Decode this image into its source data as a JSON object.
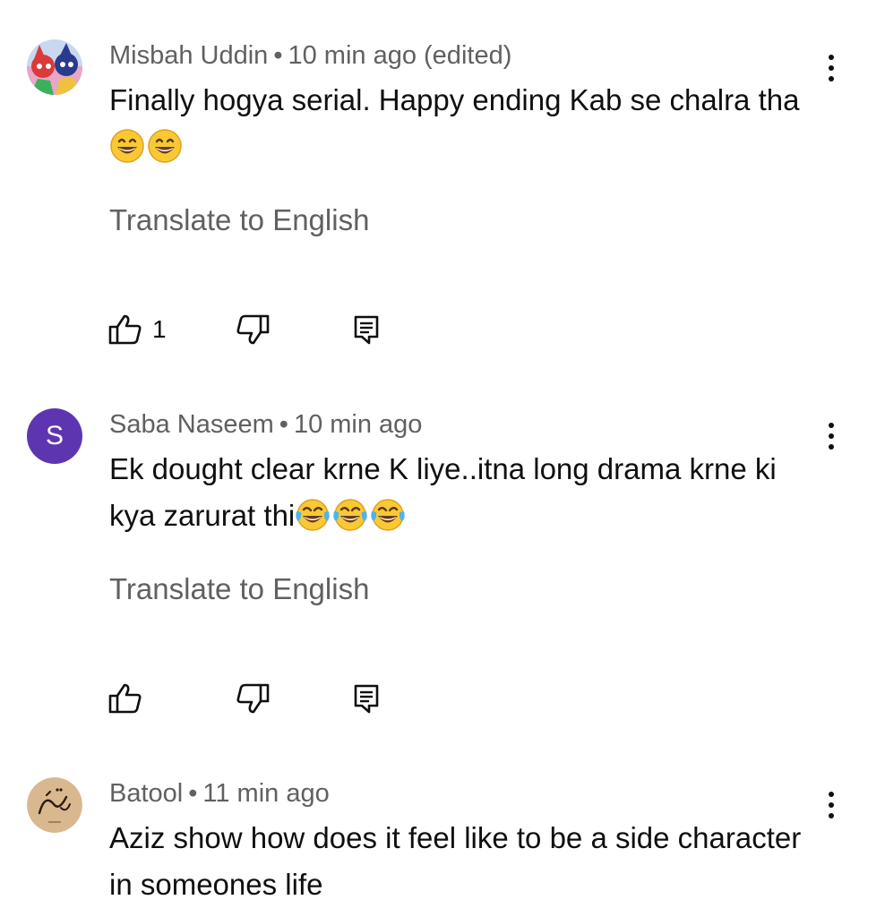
{
  "comments": [
    {
      "author": "Misbah Uddin",
      "separator": "•",
      "time": "10 min ago (edited)",
      "text": "Finally hogya serial. Happy ending Kab se chalra tha",
      "emojis": [
        "grinning-face-emoji",
        "grinning-face-emoji"
      ],
      "translate_label": "Translate to English",
      "like_count": "1",
      "avatar_type": "image"
    },
    {
      "author": "Saba Naseem",
      "separator": "•",
      "time": "10 min ago",
      "text": "Ek dought clear krne K liye..itna long drama krne ki kya zarurat thi",
      "emojis": [
        "tears-of-joy-emoji",
        "tears-of-joy-emoji",
        "tears-of-joy-emoji"
      ],
      "translate_label": "Translate to English",
      "like_count": "",
      "avatar_letter": "S",
      "avatar_color": "#5e35b1"
    },
    {
      "author": "Batool",
      "separator": "•",
      "time": "11 min ago",
      "text": "Aziz show how does it feel like to be a side character in someones life",
      "avatar_type": "calligraphy"
    }
  ],
  "icons": {
    "like": "thumbs-up-icon",
    "dislike": "thumbs-down-icon",
    "reply": "reply-comment-icon",
    "menu": "more-vertical-icon"
  },
  "colors": {
    "text_primary": "#0f0f0f",
    "text_secondary": "#606060",
    "avatar_purple": "#5e35b1"
  }
}
